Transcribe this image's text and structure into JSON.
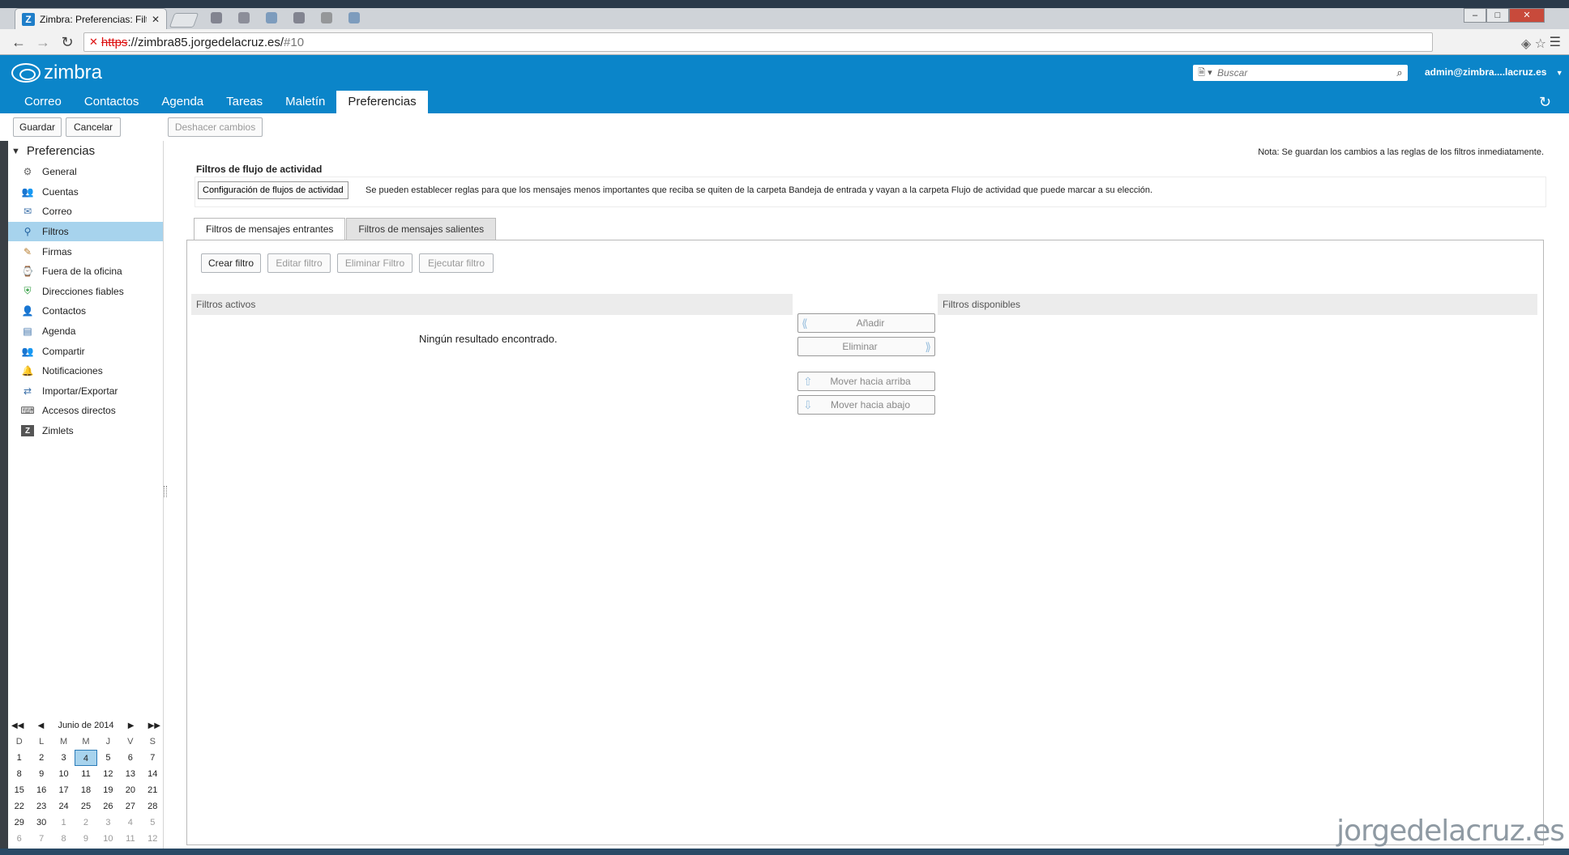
{
  "browser": {
    "tab_title": "Zimbra: Preferencias: Filtr",
    "tab_icon": "Z",
    "url_scheme": "https",
    "url_host": "://zimbra85.jorgedelacruz.es/",
    "url_hash": "#10"
  },
  "header": {
    "logo_text": "zimbra",
    "search_placeholder": "Buscar",
    "user": "admin@zimbra....lacruz.es",
    "tabs": [
      "Correo",
      "Contactos",
      "Agenda",
      "Tareas",
      "Maletín",
      "Preferencias"
    ],
    "active_tab": "Preferencias"
  },
  "toolbar": {
    "save": "Guardar",
    "cancel": "Cancelar",
    "undo": "Deshacer cambios"
  },
  "sidebar": {
    "title": "Preferencias",
    "items": [
      {
        "label": "General",
        "icon": "gear-icon"
      },
      {
        "label": "Cuentas",
        "icon": "accounts-icon"
      },
      {
        "label": "Correo",
        "icon": "mail-icon"
      },
      {
        "label": "Filtros",
        "icon": "filter-icon",
        "active": true
      },
      {
        "label": "Firmas",
        "icon": "signature-icon"
      },
      {
        "label": "Fuera de la oficina",
        "icon": "out-of-office-icon"
      },
      {
        "label": "Direcciones fiables",
        "icon": "shield-icon"
      },
      {
        "label": "Contactos",
        "icon": "contacts-icon"
      },
      {
        "label": "Agenda",
        "icon": "calendar-icon"
      },
      {
        "label": "Compartir",
        "icon": "share-icon"
      },
      {
        "label": "Notificaciones",
        "icon": "bell-icon"
      },
      {
        "label": "Importar/Exportar",
        "icon": "import-export-icon"
      },
      {
        "label": "Accesos directos",
        "icon": "shortcuts-icon"
      },
      {
        "label": "Zimlets",
        "icon": "zimlets-icon"
      }
    ]
  },
  "minical": {
    "month": "Junio de 2014",
    "days_of_week": [
      "D",
      "L",
      "M",
      "M",
      "J",
      "V",
      "S"
    ],
    "weeks": [
      [
        "1",
        "2",
        "3",
        "4",
        "5",
        "6",
        "7"
      ],
      [
        "8",
        "9",
        "10",
        "11",
        "12",
        "13",
        "14"
      ],
      [
        "15",
        "16",
        "17",
        "18",
        "19",
        "20",
        "21"
      ],
      [
        "22",
        "23",
        "24",
        "25",
        "26",
        "27",
        "28"
      ],
      [
        "29",
        "30",
        "1",
        "2",
        "3",
        "4",
        "5"
      ],
      [
        "6",
        "7",
        "8",
        "9",
        "10",
        "11",
        "12"
      ]
    ],
    "today": "4"
  },
  "content": {
    "note": "Nota: Se guardan los cambios a las reglas de los filtros inmediatamente.",
    "activity_title": "Filtros de flujo de actividad",
    "activity_button": "Configuración de flujos de actividad",
    "activity_desc": "Se pueden establecer reglas para que los mensajes menos importantes que reciba se quiten de la carpeta Bandeja de entrada y vayan a la carpeta Flujo de actividad que puede marcar a su elección.",
    "tab_incoming": "Filtros de mensajes entrantes",
    "tab_outgoing": "Filtros de mensajes salientes",
    "create_filter": "Crear filtro",
    "edit_filter": "Editar filtro",
    "delete_filter": "Eliminar Filtro",
    "run_filter": "Ejecutar filtro",
    "active_filters": "Filtros activos",
    "available_filters": "Filtros disponibles",
    "empty": "Ningún resultado encontrado.",
    "add": "Añadir",
    "remove": "Eliminar",
    "move_up": "Mover hacia arriba",
    "move_down": "Mover hacia abajo"
  },
  "watermark": "jorgedelacruz.es",
  "colors": {
    "header_blue": "#0b85c9",
    "selected": "#a7d3ed"
  }
}
